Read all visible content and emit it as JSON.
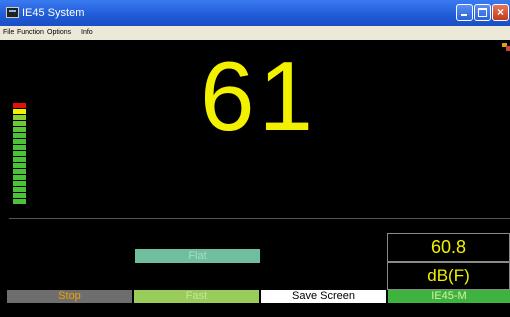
{
  "window": {
    "title": "IE45 System",
    "close_glyph": "×"
  },
  "menubar": {
    "items": [
      "File",
      "Function",
      "Options",
      "Info"
    ]
  },
  "display": {
    "reading": "61",
    "level_colors": [
      "#e01010",
      "#f2f200",
      "#8ccf30",
      "#4cc23a"
    ]
  },
  "controls": {
    "weighting_label": "Flat",
    "value": "60.8",
    "unit": "dB(F)"
  },
  "buttonbar": {
    "stop": "Stop",
    "speed": "Fast",
    "save": "Save Screen",
    "model": "IE45-M"
  },
  "colors": {
    "reading": "#f2f200",
    "titlebar": "#1f5bd6"
  }
}
